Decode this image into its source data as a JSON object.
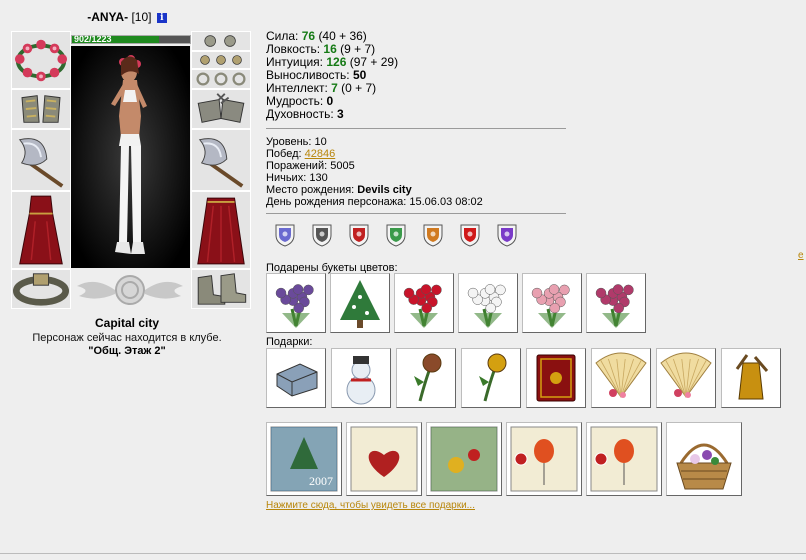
{
  "character": {
    "nick": "ANYA",
    "level_bracket": "[10]",
    "info_icon": "i",
    "hp": {
      "current": 902,
      "max": 1223,
      "text": "902/1223"
    },
    "city": "Capital city",
    "club_text": "Персонаж сейчас находится в клубе.",
    "club_name": "\"Общ. Этаж 2\""
  },
  "stats": [
    {
      "label": "Сила:",
      "value": "76",
      "extra": "(40 + 36)",
      "color": "green"
    },
    {
      "label": "Ловкость:",
      "value": "16",
      "extra": "(9 + 7)",
      "color": "green"
    },
    {
      "label": "Интуиция:",
      "value": "126",
      "extra": "(97 + 29)",
      "color": "green"
    },
    {
      "label": "Выносливость:",
      "value": "50",
      "extra": "",
      "color": "black"
    },
    {
      "label": "Интеллект:",
      "value": "7",
      "extra": "(0 + 7)",
      "color": "green"
    },
    {
      "label": "Мудрость:",
      "value": "0",
      "extra": "",
      "color": "black"
    },
    {
      "label": "Духовность:",
      "value": "3",
      "extra": "",
      "color": "black"
    }
  ],
  "info": {
    "level_label": "Уровень:",
    "level_value": "10",
    "wins_label": "Побед:",
    "wins_value": "42846",
    "losses_label": "Поражений:",
    "losses_value": "5005",
    "draws_label": "Ничьих:",
    "draws_value": "130",
    "birthplace_label": "Место рождения:",
    "birthplace_value": "Devils city",
    "birthday_label": "День рождения персонажа:",
    "birthday_value": "15.06.03 08:02"
  },
  "badges": [
    {
      "icon": "purple-shield-icon",
      "color": "#6a6ad0"
    },
    {
      "icon": "gray-shield-icon",
      "color": "#555555"
    },
    {
      "icon": "red-shield-icon",
      "color": "#c02020"
    },
    {
      "icon": "green-shield-icon",
      "color": "#3a9a4a"
    },
    {
      "icon": "orange-shield-icon",
      "color": "#d07a20"
    },
    {
      "icon": "red-flower-badge-icon",
      "color": "#d01818"
    },
    {
      "icon": "violet-orb-badge-icon",
      "color": "#7a3ac8"
    }
  ],
  "flowers_label": "Подарены букеты цветов:",
  "flowers": [
    {
      "icon": "violet-bouquet-icon",
      "color": "#6a4a9a"
    },
    {
      "icon": "christmas-tree-icon",
      "color": "#2f7a3a"
    },
    {
      "icon": "red-roses-bouquet-icon",
      "color": "#c8142a"
    },
    {
      "icon": "daisy-bouquet-icon",
      "color": "#f4f4f4"
    },
    {
      "icon": "pink-branch-bouquet-icon",
      "color": "#e8a0b0"
    },
    {
      "icon": "pink-flowers-bouquet-icon",
      "color": "#b03a6a"
    }
  ],
  "gifts_label": "Подарки:",
  "gifts": [
    {
      "icon": "silver-box-icon",
      "color": "#8aa0b8"
    },
    {
      "icon": "snowman-icon",
      "color": "#e8eef4"
    },
    {
      "icon": "rose-branch-icon",
      "color": "#8a4a2a"
    },
    {
      "icon": "golden-rose-icon",
      "color": "#d4a010"
    },
    {
      "icon": "red-book-icon",
      "color": "#8a1010"
    },
    {
      "icon": "fan-icon",
      "color": "#f0dca0"
    },
    {
      "icon": "fan-icon",
      "color": "#f0dca0"
    },
    {
      "icon": "golden-vase-icon",
      "color": "#c89010"
    }
  ],
  "cards": [
    {
      "icon": "new-year-card-icon",
      "color": "#2a6a9a",
      "text": "2007"
    },
    {
      "icon": "heart-card-icon",
      "color": "#b02020",
      "text": ""
    },
    {
      "icon": "christmas-ornament-card-icon",
      "color": "#2a7a3a",
      "text": ""
    },
    {
      "icon": "balloon-card-icon",
      "color": "#e05020",
      "text": ""
    },
    {
      "icon": "balloon-card-icon",
      "color": "#e05020",
      "text": ""
    },
    {
      "icon": "flower-basket-icon",
      "color": "#9a6a30",
      "text": ""
    }
  ],
  "see_all_link": "Нажмите сюда, чтобы увидеть все подарки...",
  "edge_link": "е"
}
